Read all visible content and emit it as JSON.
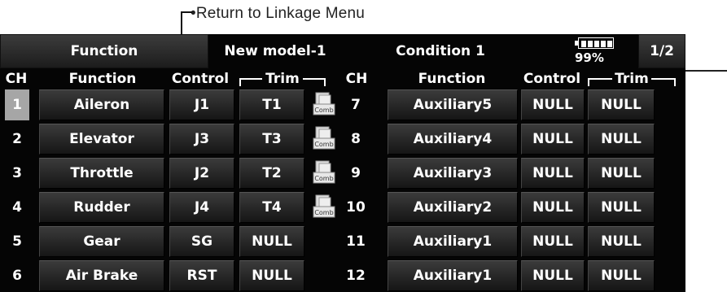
{
  "callout": {
    "label": "•Return to Linkage Menu"
  },
  "header": {
    "menu_button": "Function",
    "model_name": "New model-1",
    "condition": "Condition 1",
    "battery_percent": "99%",
    "page_button": "1/2"
  },
  "columns": {
    "ch": "CH",
    "function": "Function",
    "control": "Control",
    "trim": "Trim"
  },
  "left_rows": [
    {
      "ch": "1",
      "function": "Aileron",
      "control": "J1",
      "trim": "T1",
      "comb_icon": true
    },
    {
      "ch": "2",
      "function": "Elevator",
      "control": "J3",
      "trim": "T3",
      "comb_icon": true
    },
    {
      "ch": "3",
      "function": "Throttle",
      "control": "J2",
      "trim": "T2",
      "comb_icon": true
    },
    {
      "ch": "4",
      "function": "Rudder",
      "control": "J4",
      "trim": "T4",
      "comb_icon": true
    },
    {
      "ch": "5",
      "function": "Gear",
      "control": "SG",
      "trim": "NULL",
      "comb_icon": false
    },
    {
      "ch": "6",
      "function": "Air Brake",
      "control": "RST",
      "trim": "NULL",
      "comb_icon": false
    }
  ],
  "right_rows": [
    {
      "ch": "7",
      "function": "Auxiliary5",
      "control": "NULL",
      "trim": "NULL"
    },
    {
      "ch": "8",
      "function": "Auxiliary4",
      "control": "NULL",
      "trim": "NULL"
    },
    {
      "ch": "9",
      "function": "Auxiliary3",
      "control": "NULL",
      "trim": "NULL"
    },
    {
      "ch": "10",
      "function": "Auxiliary2",
      "control": "NULL",
      "trim": "NULL"
    },
    {
      "ch": "11",
      "function": "Auxiliary1",
      "control": "NULL",
      "trim": "NULL"
    },
    {
      "ch": "12",
      "function": "Auxiliary1",
      "control": "NULL",
      "trim": "NULL"
    }
  ],
  "comb_icon_label": "Comb",
  "selected_channel": "1"
}
